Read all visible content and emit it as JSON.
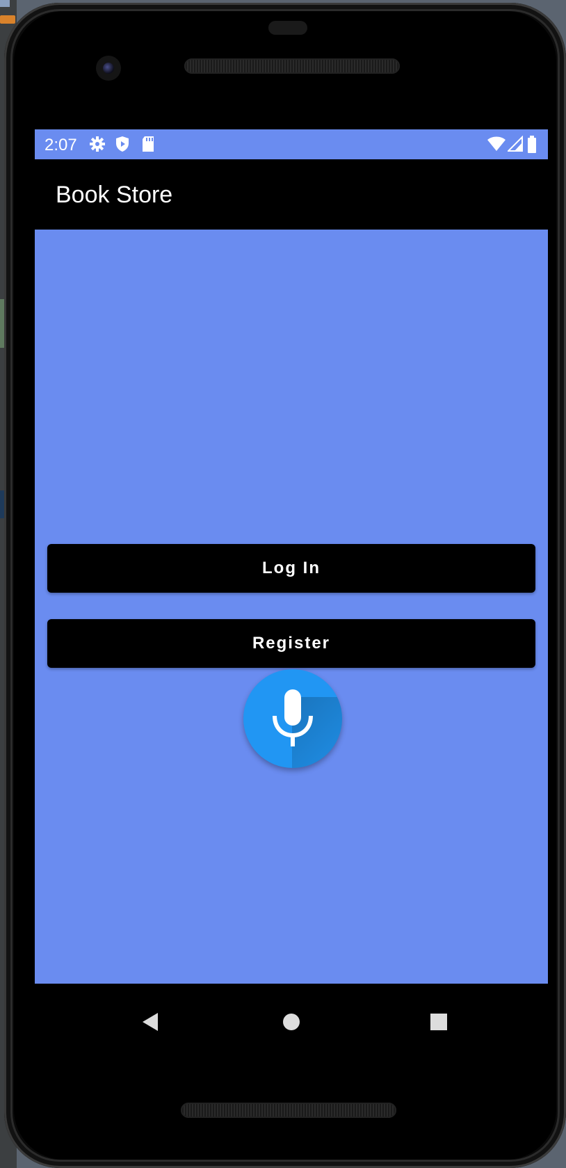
{
  "status_bar": {
    "time": "2:07",
    "icons": [
      "settings-icon",
      "shield-icon",
      "sd-card-icon",
      "wifi-icon",
      "signal-icon",
      "battery-icon"
    ],
    "background_color": "#6a8cf0"
  },
  "app_bar": {
    "title": "Book Store",
    "background_color": "#000000"
  },
  "main": {
    "background_color": "#6a8cf0",
    "login_button": {
      "label": "Log In"
    },
    "register_button": {
      "label": "Register"
    },
    "voice_button": {
      "icon": "microphone-icon",
      "color": "#2196f3"
    }
  },
  "nav_bar": {
    "buttons": [
      "back-icon",
      "home-icon",
      "recents-icon"
    ]
  }
}
